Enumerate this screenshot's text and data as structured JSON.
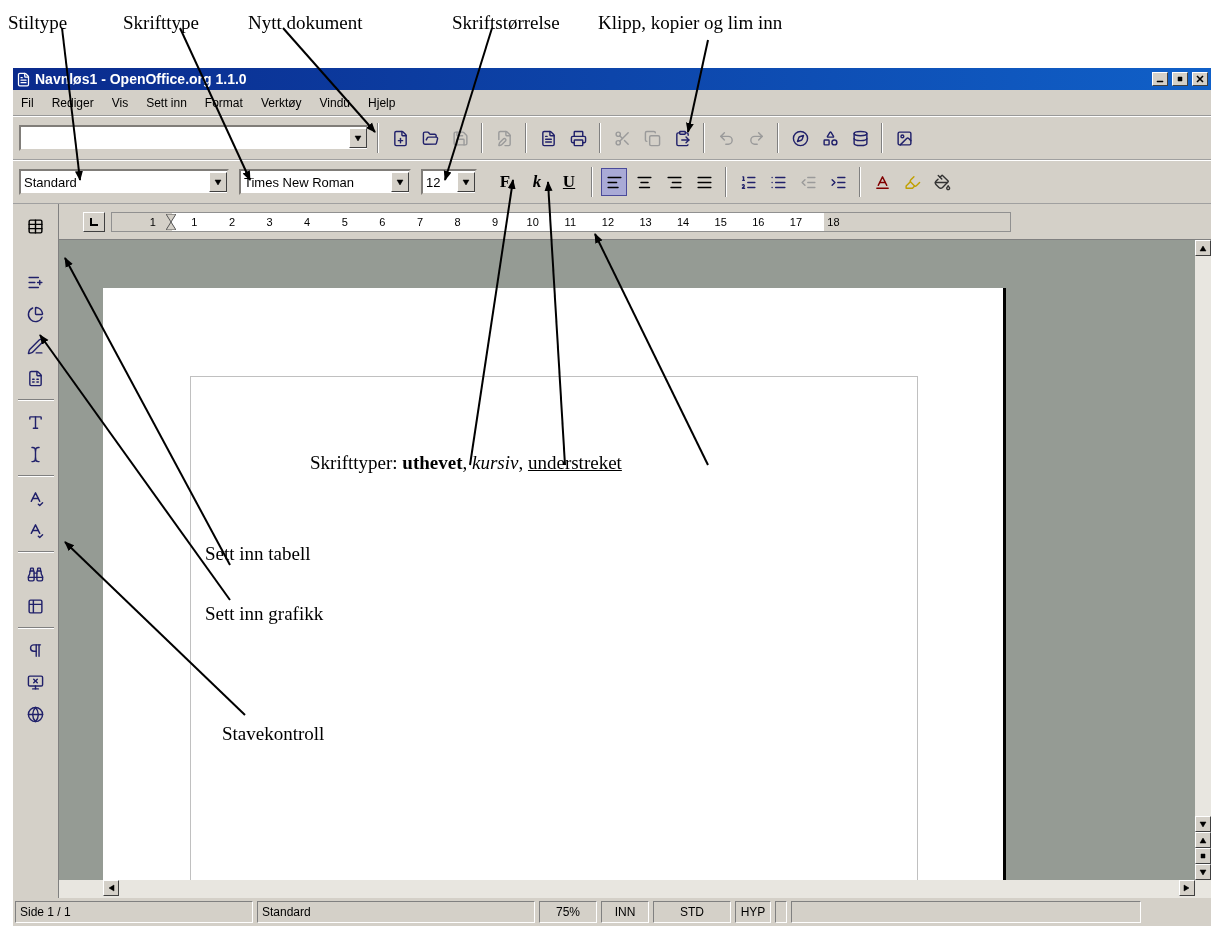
{
  "annotations": {
    "top": [
      "Stiltype",
      "Skrifttype",
      "Nytt dokument",
      "Skriftstørrelse",
      "Klipp, kopier og lim inn"
    ],
    "styles_note": {
      "text": "Skrifttyper: **uthevet**, *kursiv*, ",
      "underlined": "understreket"
    },
    "side": [
      "Sett inn tabell",
      "Sett inn grafikk",
      "Stavekontroll"
    ]
  },
  "window": {
    "title": "Navnløs1 - OpenOffice.org 1.1.0"
  },
  "menu": [
    "Fil",
    "Rediger",
    "Vis",
    "Sett inn",
    "Format",
    "Verktøy",
    "Vindu",
    "Hjelp"
  ],
  "standard_toolbar": {
    "buttons": [
      {
        "disabled": false
      },
      {
        "disabled": false
      },
      {
        "disabled": true
      },
      {
        "disabled": true
      },
      {
        "disabled": false
      },
      {
        "disabled": false
      },
      {
        "disabled": true
      },
      {
        "disabled": true
      },
      {
        "disabled": false
      },
      {
        "disabled": true
      },
      {
        "disabled": true
      },
      {
        "disabled": false
      },
      {
        "disabled": false
      },
      {
        "disabled": false
      },
      {
        "disabled": false
      }
    ]
  },
  "format_toolbar": {
    "style": "Standard",
    "font": "Times New Roman",
    "size": "12",
    "bold": "F",
    "italic": "k",
    "underline": "U",
    "alignment": [
      {
        "selected": true
      },
      {
        "selected": false
      },
      {
        "selected": false
      },
      {
        "selected": false
      }
    ],
    "list_buttons": [
      {
        "disabled": false
      },
      {
        "disabled": false
      },
      {
        "disabled": true
      },
      {
        "disabled": false
      }
    ]
  },
  "ruler": [
    "1",
    "1",
    "2",
    "3",
    "4",
    "5",
    "6",
    "7",
    "8",
    "9",
    "10",
    "11",
    "12",
    "13",
    "14",
    "15",
    "16",
    "17",
    "18"
  ],
  "status_bar": [
    "Side 1 / 1",
    "Standard",
    "75%",
    "INN",
    "STD",
    "HYP"
  ]
}
